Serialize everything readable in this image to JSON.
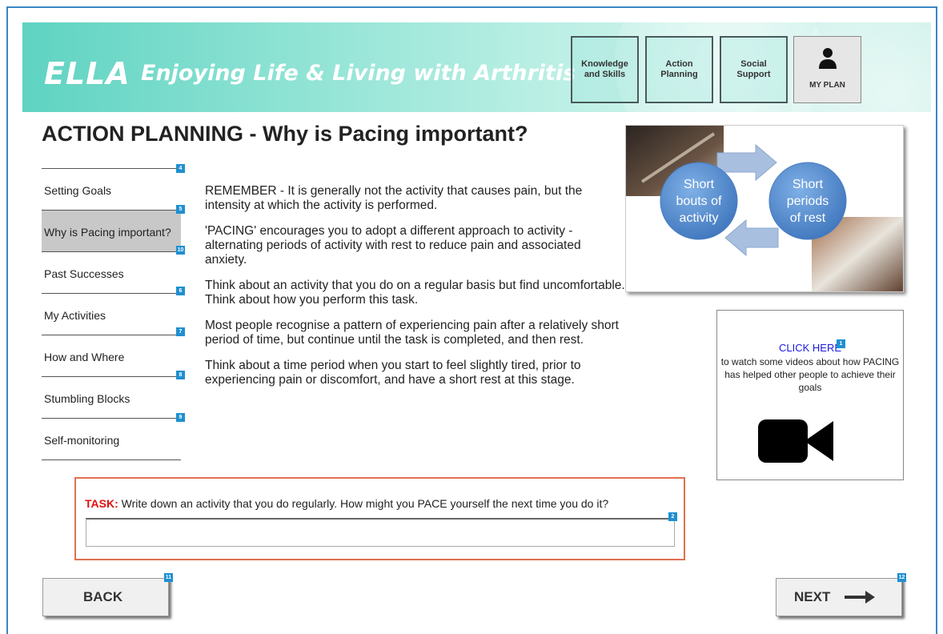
{
  "header": {
    "logo": "ELLA",
    "tagline": "Enjoying Life & Living with Arthritis",
    "nav": [
      {
        "label": "Knowledge\nand Skills"
      },
      {
        "label": "Action\nPlanning"
      },
      {
        "label": "Social\nSupport"
      }
    ],
    "my_plan_label": "MY PLAN",
    "my_plan_icon": "person-icon"
  },
  "page": {
    "title": "ACTION PLANNING - Why is Pacing important?"
  },
  "sidebar": {
    "badges": [
      "4",
      "5",
      "10",
      "6",
      "7",
      "8",
      "9"
    ],
    "items": [
      {
        "label": "Setting Goals",
        "active": false
      },
      {
        "label": "Why is Pacing important?",
        "active": true
      },
      {
        "label": "Past Successes",
        "active": false
      },
      {
        "label": "My Activities",
        "active": false
      },
      {
        "label": "How and Where",
        "active": false
      },
      {
        "label": "Stumbling Blocks",
        "active": false
      },
      {
        "label": "Self-monitoring",
        "active": false
      }
    ]
  },
  "content": {
    "paragraphs": [
      "REMEMBER - It is generally not the activity that causes pain, but the intensity at which the activity is performed.",
      "'PACING' encourages you to adopt a different approach to activity - alternating periods of activity with rest to reduce pain and associated anxiety.",
      "Think about an activity that you do on a regular basis but find uncomfortable. Think about how you perform this task.",
      "Most people recognise a pattern of experiencing pain after a relatively short period of time, but continue until the task is completed, and then rest.",
      "Think about a time period when you start to feel slightly tired, prior to experiencing pain or discomfort, and have a short rest at this stage."
    ]
  },
  "diagram": {
    "left_circle": [
      "Short",
      "bouts of",
      "activity"
    ],
    "right_circle": [
      "Short",
      "periods",
      "of rest"
    ],
    "colors": {
      "circle": "#5b8fd0",
      "arrow": "#a8bfe0"
    }
  },
  "video": {
    "link_label": "CLICK HERE",
    "badge": "1",
    "description": "to watch some videos about how PACING has helped other people to achieve their goals",
    "icon": "video-camera-icon"
  },
  "task": {
    "lead": "TASK:",
    "prompt": "Write down an activity that you do regularly. How might you PACE yourself the next time you do it?",
    "input_value": "",
    "badge": "2"
  },
  "footer": {
    "back_label": "BACK",
    "back_badge": "11",
    "next_label": "NEXT",
    "next_badge": "12"
  },
  "colors": {
    "accent_blue": "#1f8fd1",
    "task_border": "#e07050",
    "task_lead": "#e01010",
    "link": "#1a1ae0"
  }
}
